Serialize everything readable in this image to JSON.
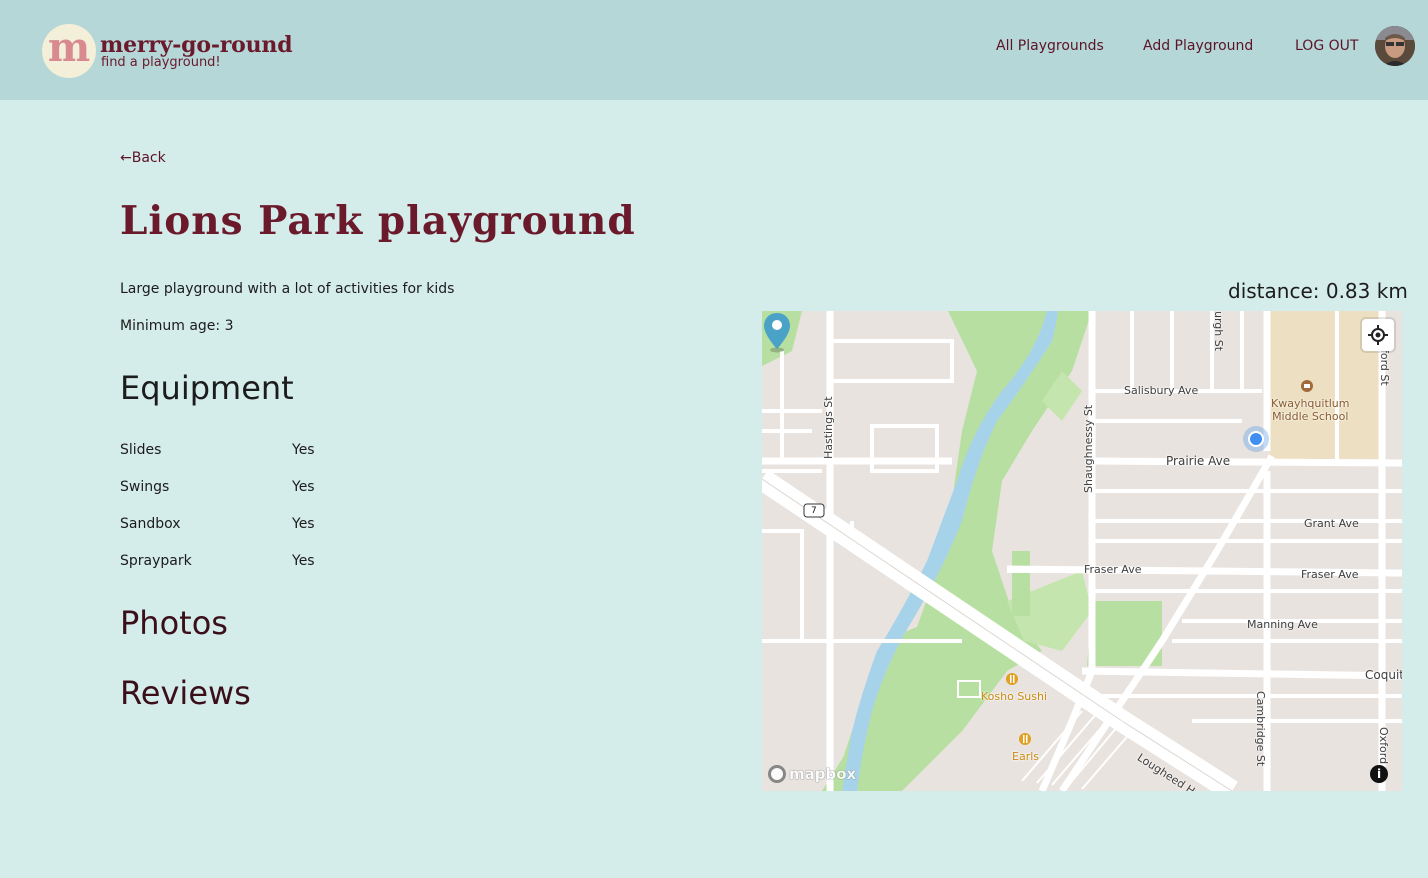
{
  "header": {
    "logo_letter": "m",
    "brand_name": "merry-go-round",
    "tagline": "find a playground!",
    "nav": {
      "all_playgrounds": "All Playgrounds",
      "add_playground": "Add Playground",
      "log_out": "LOG OUT"
    }
  },
  "back_label": "←Back",
  "playground": {
    "title": "Lions Park playground",
    "description": "Large playground with a lot of activities for kids",
    "min_age_label": "Minimum age: 3"
  },
  "sections": {
    "equipment": "Equipment",
    "photos": "Photos",
    "reviews": "Reviews"
  },
  "equipment": [
    {
      "name": "Slides",
      "value": "Yes"
    },
    {
      "name": "Swings",
      "value": "Yes"
    },
    {
      "name": "Sandbox",
      "value": "Yes"
    },
    {
      "name": "Spraypark",
      "value": "Yes"
    }
  ],
  "distance_label": "distance: 0.83 km",
  "map": {
    "labels": {
      "hastings": "Hastings St",
      "shaughnessy": "Shaughnessy St",
      "salisbury": "Salisbury Ave",
      "prairie": "Prairie Ave",
      "grant": "Grant Ave",
      "fraser_west": "Fraser Ave",
      "fraser_east": "Fraser Ave",
      "manning": "Manning Ave",
      "coquit": "Coquit",
      "cambridge": "Cambridge St",
      "oxford": "Oxford",
      "lougheed": "Lougheed Hwy",
      "urgh": "urgh St",
      "ford": "ford St",
      "school": "Kwayhquitlum\nMiddle School",
      "kosho": "Kosho Sushi",
      "earls": "Earls",
      "route": "7"
    },
    "attribution": "mapbox",
    "info": "i"
  },
  "colors": {
    "header_bg": "#b5d7d8",
    "page_bg": "#d4ecea",
    "brand": "#6b1a2c",
    "park": "#b7dfa1",
    "water": "#a7d3ea",
    "user_location": "#3f8ff0",
    "pin": "#4aa3c7"
  }
}
